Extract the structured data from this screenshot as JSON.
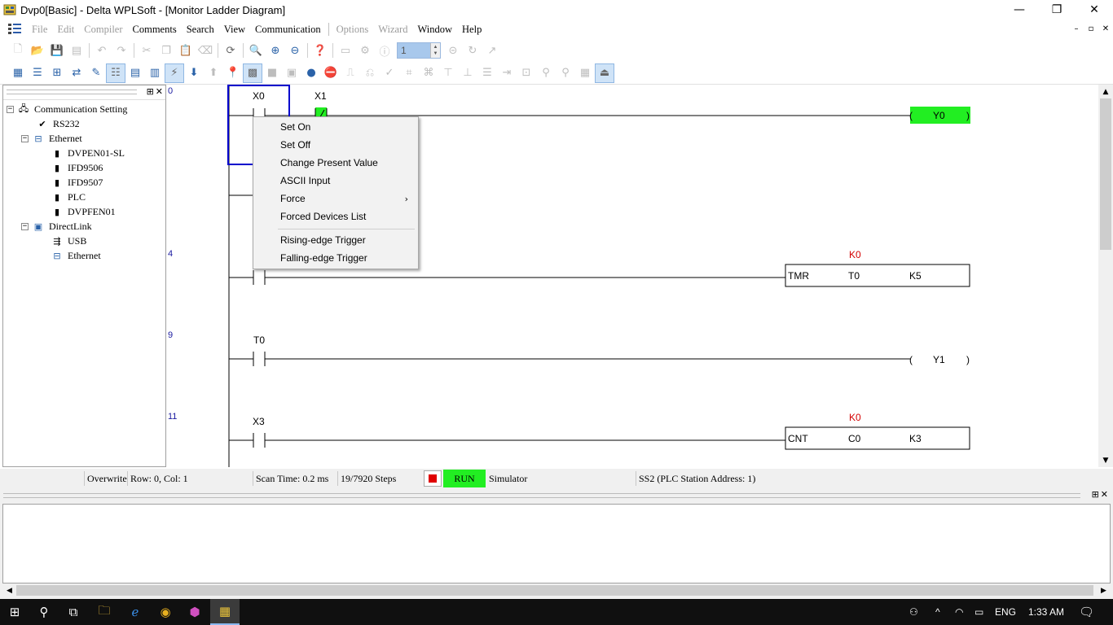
{
  "window": {
    "title": "Dvp0[Basic] - Delta WPLSoft - [Monitor Ladder Diagram]",
    "minimize": "—",
    "restore": "❐",
    "close": "✕"
  },
  "menu": {
    "items": [
      {
        "label": "File",
        "enabled": false
      },
      {
        "label": "Edit",
        "enabled": false
      },
      {
        "label": "Compiler",
        "enabled": false
      },
      {
        "label": "Comments",
        "enabled": true
      },
      {
        "label": "Search",
        "enabled": true
      },
      {
        "label": "View",
        "enabled": true
      },
      {
        "label": "Communication",
        "enabled": true
      },
      {
        "label": "Options",
        "enabled": false
      },
      {
        "label": "Wizard",
        "enabled": false
      },
      {
        "label": "Window",
        "enabled": true
      },
      {
        "label": "Help",
        "enabled": true
      }
    ]
  },
  "toolbar": {
    "step_value": "1"
  },
  "comm_tree": {
    "root": "Communication Setting",
    "rs232": "RS232",
    "ethernet": "Ethernet",
    "ethernet_children": [
      "DVPEN01-SL",
      "IFD9506",
      "IFD9507",
      "PLC",
      "DVPFEN01"
    ],
    "directlink": "DirectLink",
    "directlink_children": [
      "USB",
      "Ethernet"
    ]
  },
  "ladder": {
    "rung_numbers": [
      "0",
      "4",
      "9",
      "11"
    ],
    "rung0": {
      "contact1": "X0",
      "contact2": "X1",
      "coil": "Y0"
    },
    "rung4": {
      "k_value": "K0",
      "instr": "TMR",
      "op1": "T0",
      "op2": "K5"
    },
    "rung9": {
      "contact": "T0",
      "coil": "Y1"
    },
    "rung11": {
      "contact": "X3",
      "k_value": "K0",
      "instr": "CNT",
      "op1": "C0",
      "op2": "K3"
    },
    "colors": {
      "energized": "#22ee22",
      "selection": "#0000cc",
      "kvalue": "#d40000"
    }
  },
  "context_menu": {
    "items": [
      "Set On",
      "Set Off",
      "Change Present Value",
      "ASCII Input",
      "Force",
      "Forced Devices List",
      "Rising-edge Trigger",
      "Falling-edge Trigger"
    ]
  },
  "status": {
    "mode": "Overwrite",
    "position": "Row: 0, Col: 1",
    "scan_time": "Scan Time: 0.2 ms",
    "steps": "19/7920 Steps",
    "run": "RUN",
    "simulator": "Simulator",
    "station": "SS2 (PLC Station Address: 1)"
  },
  "taskbar": {
    "language": "ENG",
    "time": "1:33 AM"
  }
}
